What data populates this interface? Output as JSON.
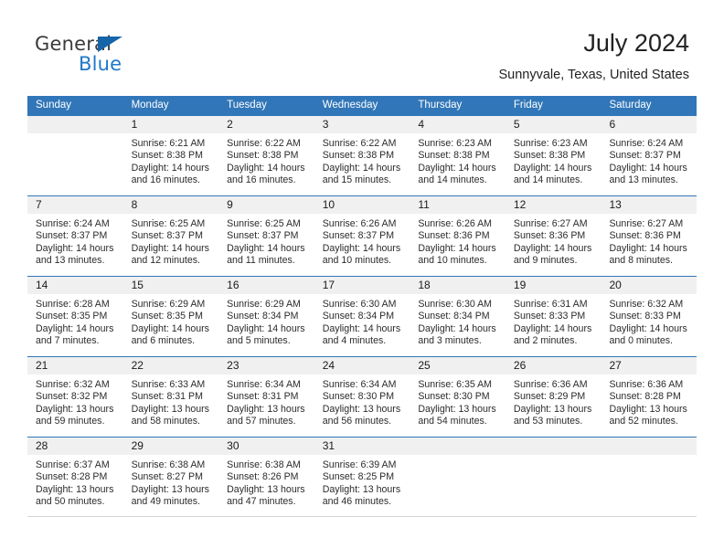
{
  "brand": {
    "name_top": "General",
    "name_bottom": "Blue",
    "triangle_color": "#1565a8",
    "blue_color": "#1f78c8"
  },
  "header": {
    "title": "July 2024",
    "subtitle": "Sunnyvale, Texas, United States",
    "header_bg": "#3176b8",
    "day_band_bg": "#f0f0f0"
  },
  "calendar": {
    "weekday_headers": [
      "Sunday",
      "Monday",
      "Tuesday",
      "Wednesday",
      "Thursday",
      "Friday",
      "Saturday"
    ],
    "labels": {
      "sunrise_prefix": "Sunrise:",
      "sunset_prefix": "Sunset:",
      "daylight_prefix": "Daylight:"
    },
    "weeks": [
      [
        {
          "date": "",
          "empty": true
        },
        {
          "date": "1",
          "sunrise": "Sunrise: 6:21 AM",
          "sunset": "Sunset: 8:38 PM",
          "daylight_1": "Daylight: 14 hours",
          "daylight_2": "and 16 minutes."
        },
        {
          "date": "2",
          "sunrise": "Sunrise: 6:22 AM",
          "sunset": "Sunset: 8:38 PM",
          "daylight_1": "Daylight: 14 hours",
          "daylight_2": "and 16 minutes."
        },
        {
          "date": "3",
          "sunrise": "Sunrise: 6:22 AM",
          "sunset": "Sunset: 8:38 PM",
          "daylight_1": "Daylight: 14 hours",
          "daylight_2": "and 15 minutes."
        },
        {
          "date": "4",
          "sunrise": "Sunrise: 6:23 AM",
          "sunset": "Sunset: 8:38 PM",
          "daylight_1": "Daylight: 14 hours",
          "daylight_2": "and 14 minutes."
        },
        {
          "date": "5",
          "sunrise": "Sunrise: 6:23 AM",
          "sunset": "Sunset: 8:38 PM",
          "daylight_1": "Daylight: 14 hours",
          "daylight_2": "and 14 minutes."
        },
        {
          "date": "6",
          "sunrise": "Sunrise: 6:24 AM",
          "sunset": "Sunset: 8:37 PM",
          "daylight_1": "Daylight: 14 hours",
          "daylight_2": "and 13 minutes."
        }
      ],
      [
        {
          "date": "7",
          "sunrise": "Sunrise: 6:24 AM",
          "sunset": "Sunset: 8:37 PM",
          "daylight_1": "Daylight: 14 hours",
          "daylight_2": "and 13 minutes."
        },
        {
          "date": "8",
          "sunrise": "Sunrise: 6:25 AM",
          "sunset": "Sunset: 8:37 PM",
          "daylight_1": "Daylight: 14 hours",
          "daylight_2": "and 12 minutes."
        },
        {
          "date": "9",
          "sunrise": "Sunrise: 6:25 AM",
          "sunset": "Sunset: 8:37 PM",
          "daylight_1": "Daylight: 14 hours",
          "daylight_2": "and 11 minutes."
        },
        {
          "date": "10",
          "sunrise": "Sunrise: 6:26 AM",
          "sunset": "Sunset: 8:37 PM",
          "daylight_1": "Daylight: 14 hours",
          "daylight_2": "and 10 minutes."
        },
        {
          "date": "11",
          "sunrise": "Sunrise: 6:26 AM",
          "sunset": "Sunset: 8:36 PM",
          "daylight_1": "Daylight: 14 hours",
          "daylight_2": "and 10 minutes."
        },
        {
          "date": "12",
          "sunrise": "Sunrise: 6:27 AM",
          "sunset": "Sunset: 8:36 PM",
          "daylight_1": "Daylight: 14 hours",
          "daylight_2": "and 9 minutes."
        },
        {
          "date": "13",
          "sunrise": "Sunrise: 6:27 AM",
          "sunset": "Sunset: 8:36 PM",
          "daylight_1": "Daylight: 14 hours",
          "daylight_2": "and 8 minutes."
        }
      ],
      [
        {
          "date": "14",
          "sunrise": "Sunrise: 6:28 AM",
          "sunset": "Sunset: 8:35 PM",
          "daylight_1": "Daylight: 14 hours",
          "daylight_2": "and 7 minutes."
        },
        {
          "date": "15",
          "sunrise": "Sunrise: 6:29 AM",
          "sunset": "Sunset: 8:35 PM",
          "daylight_1": "Daylight: 14 hours",
          "daylight_2": "and 6 minutes."
        },
        {
          "date": "16",
          "sunrise": "Sunrise: 6:29 AM",
          "sunset": "Sunset: 8:34 PM",
          "daylight_1": "Daylight: 14 hours",
          "daylight_2": "and 5 minutes."
        },
        {
          "date": "17",
          "sunrise": "Sunrise: 6:30 AM",
          "sunset": "Sunset: 8:34 PM",
          "daylight_1": "Daylight: 14 hours",
          "daylight_2": "and 4 minutes."
        },
        {
          "date": "18",
          "sunrise": "Sunrise: 6:30 AM",
          "sunset": "Sunset: 8:34 PM",
          "daylight_1": "Daylight: 14 hours",
          "daylight_2": "and 3 minutes."
        },
        {
          "date": "19",
          "sunrise": "Sunrise: 6:31 AM",
          "sunset": "Sunset: 8:33 PM",
          "daylight_1": "Daylight: 14 hours",
          "daylight_2": "and 2 minutes."
        },
        {
          "date": "20",
          "sunrise": "Sunrise: 6:32 AM",
          "sunset": "Sunset: 8:33 PM",
          "daylight_1": "Daylight: 14 hours",
          "daylight_2": "and 0 minutes."
        }
      ],
      [
        {
          "date": "21",
          "sunrise": "Sunrise: 6:32 AM",
          "sunset": "Sunset: 8:32 PM",
          "daylight_1": "Daylight: 13 hours",
          "daylight_2": "and 59 minutes."
        },
        {
          "date": "22",
          "sunrise": "Sunrise: 6:33 AM",
          "sunset": "Sunset: 8:31 PM",
          "daylight_1": "Daylight: 13 hours",
          "daylight_2": "and 58 minutes."
        },
        {
          "date": "23",
          "sunrise": "Sunrise: 6:34 AM",
          "sunset": "Sunset: 8:31 PM",
          "daylight_1": "Daylight: 13 hours",
          "daylight_2": "and 57 minutes."
        },
        {
          "date": "24",
          "sunrise": "Sunrise: 6:34 AM",
          "sunset": "Sunset: 8:30 PM",
          "daylight_1": "Daylight: 13 hours",
          "daylight_2": "and 56 minutes."
        },
        {
          "date": "25",
          "sunrise": "Sunrise: 6:35 AM",
          "sunset": "Sunset: 8:30 PM",
          "daylight_1": "Daylight: 13 hours",
          "daylight_2": "and 54 minutes."
        },
        {
          "date": "26",
          "sunrise": "Sunrise: 6:36 AM",
          "sunset": "Sunset: 8:29 PM",
          "daylight_1": "Daylight: 13 hours",
          "daylight_2": "and 53 minutes."
        },
        {
          "date": "27",
          "sunrise": "Sunrise: 6:36 AM",
          "sunset": "Sunset: 8:28 PM",
          "daylight_1": "Daylight: 13 hours",
          "daylight_2": "and 52 minutes."
        }
      ],
      [
        {
          "date": "28",
          "sunrise": "Sunrise: 6:37 AM",
          "sunset": "Sunset: 8:28 PM",
          "daylight_1": "Daylight: 13 hours",
          "daylight_2": "and 50 minutes."
        },
        {
          "date": "29",
          "sunrise": "Sunrise: 6:38 AM",
          "sunset": "Sunset: 8:27 PM",
          "daylight_1": "Daylight: 13 hours",
          "daylight_2": "and 49 minutes."
        },
        {
          "date": "30",
          "sunrise": "Sunrise: 6:38 AM",
          "sunset": "Sunset: 8:26 PM",
          "daylight_1": "Daylight: 13 hours",
          "daylight_2": "and 47 minutes."
        },
        {
          "date": "31",
          "sunrise": "Sunrise: 6:39 AM",
          "sunset": "Sunset: 8:25 PM",
          "daylight_1": "Daylight: 13 hours",
          "daylight_2": "and 46 minutes."
        },
        {
          "date": "",
          "empty": true
        },
        {
          "date": "",
          "empty": true
        },
        {
          "date": "",
          "empty": true
        }
      ]
    ]
  }
}
